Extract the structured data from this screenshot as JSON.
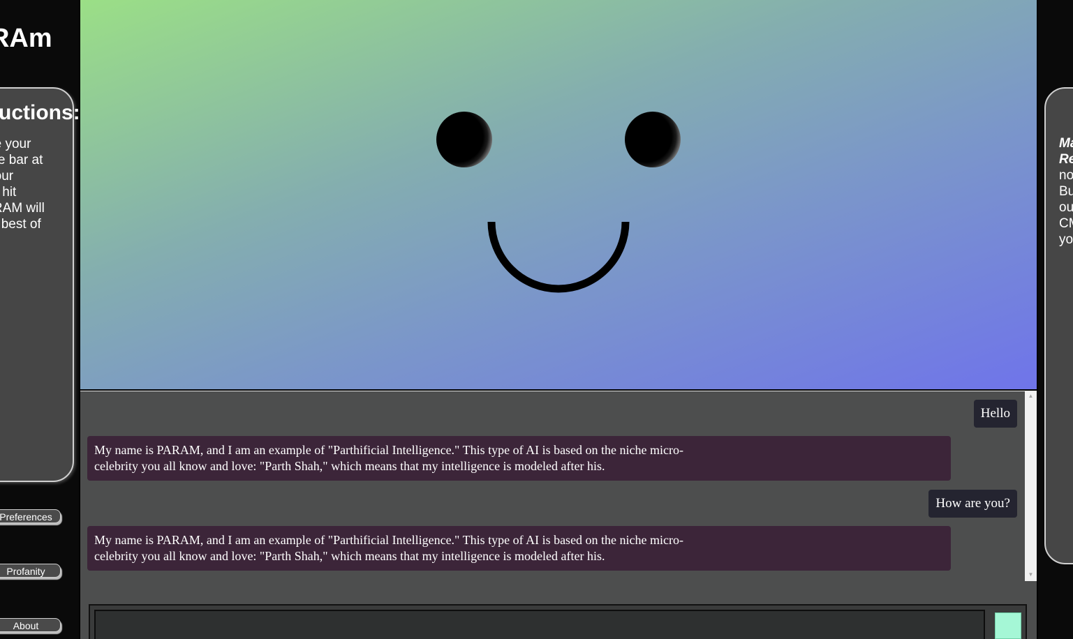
{
  "sidebar": {
    "brand_title": "PARAm",
    "instructions_heading": "Instructions:",
    "instructions_lines": [
      "Type your",
      "in the bar at",
      "of your",
      "then hit",
      "PARAM will",
      "the best of"
    ],
    "buttons": {
      "preferences": "Preferences",
      "profanity": "Profanity",
      "about": "About"
    }
  },
  "face": {
    "gradient_start": "#9bdf86",
    "gradient_end": "#6f74ea"
  },
  "chat": {
    "messages": [
      {
        "role": "user",
        "text": "Hello"
      },
      {
        "role": "bot",
        "lines": [
          "My name is PARAM, and I am an example of \"Parthificial Intelligence.\" This type of AI is based on the niche micro-",
          "celebrity you all know and love: \"Parth Shah,\" which means that my intelligence is modeled after his."
        ]
      },
      {
        "role": "user",
        "text": "How are you?"
      },
      {
        "role": "bot",
        "lines": [
          "My name is PARAM, and I am an example of \"Parthificial Intelligence.\" This type of AI is based on the niche micro-",
          "celebrity you all know and love: \"Parth Shah,\" which means that my intelligence is modeled after his."
        ]
      }
    ],
    "input_placeholder": "",
    "input_value": "",
    "send_button_color": "#a5f7d6"
  },
  "info_panel": {
    "lines": [
      {
        "text": "Made",
        "em": true
      },
      {
        "text": "Re",
        "em": true
      },
      {
        "text": "no",
        "em": false
      },
      {
        "text": "Bu",
        "em": false
      },
      {
        "text": "ou",
        "em": false
      },
      {
        "text": "CM",
        "em": false
      },
      {
        "text": "yo",
        "em": false
      }
    ]
  },
  "icons": {
    "scroll_up": "scroll-up-arrow-icon",
    "scroll_down": "scroll-down-arrow-icon"
  }
}
